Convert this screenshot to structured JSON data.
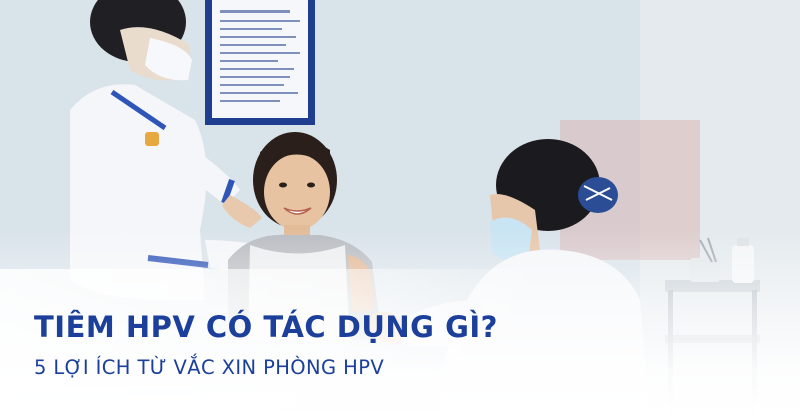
{
  "banner": {
    "headline": "TIÊM HPV CÓ TÁC DỤNG GÌ?",
    "subline": "5 LỢI ÍCH TỪ VẮC XIN PHÒNG HPV"
  },
  "colors": {
    "text_accent": "#1b3f9a",
    "uniform_trim": "#2f55b8",
    "uniform": "#f4f6f9"
  },
  "photo": {
    "subjects": [
      "nurse-left",
      "smiling-girl",
      "nurse-right",
      "medical-trolley",
      "poster"
    ]
  }
}
